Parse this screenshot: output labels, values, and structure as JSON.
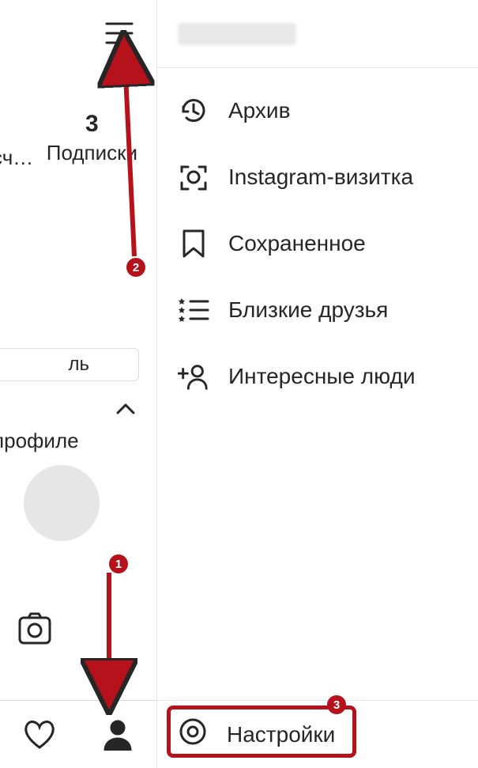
{
  "profile": {
    "stat_value": "3",
    "stat_label": "Подписки",
    "prev_stat_label_fragment": "сч…",
    "edit_button_fragment": "ль",
    "highlights_fragment": "в профиле"
  },
  "menu": {
    "username_hidden": true,
    "items": [
      {
        "icon": "history-icon",
        "label": "Архив"
      },
      {
        "icon": "nametag-icon",
        "label": "Instagram-визитка"
      },
      {
        "icon": "bookmark-icon",
        "label": "Сохраненное"
      },
      {
        "icon": "close-friends-icon",
        "label": "Близкие друзья"
      },
      {
        "icon": "discover-people-icon",
        "label": "Интересные люди"
      }
    ],
    "footer": {
      "icon": "settings-icon",
      "label": "Настройки"
    }
  },
  "annotations": {
    "step1": "1",
    "step2": "2",
    "step3": "3"
  }
}
